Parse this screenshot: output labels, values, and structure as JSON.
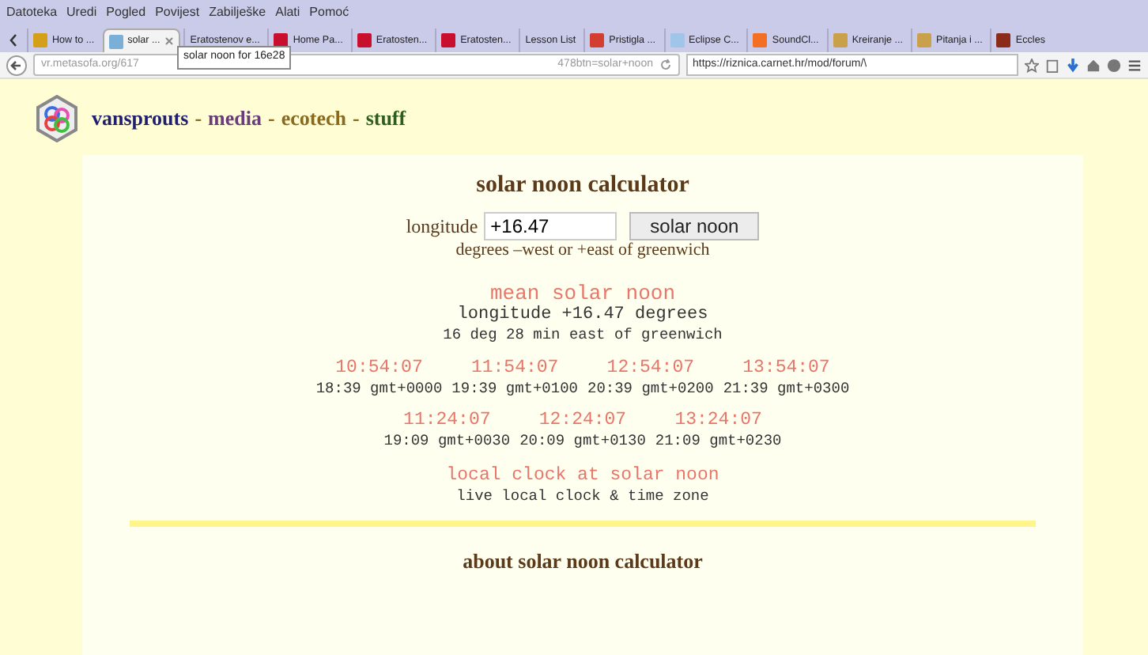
{
  "menu": [
    "Datoteka",
    "Uredi",
    "Pogled",
    "Povijest",
    "Zabilješke",
    "Alati",
    "Pomoć"
  ],
  "tabs": [
    {
      "label": "How to ...",
      "selected": false,
      "color": "#d4a017"
    },
    {
      "label": "solar ...",
      "selected": true,
      "color": "#7ab0d8"
    },
    {
      "label": "Eratostenov e...",
      "selected": false
    },
    {
      "label": "Home Pa...",
      "selected": false,
      "color": "#c8102e"
    },
    {
      "label": "Eratosten...",
      "selected": false,
      "color": "#c8102e"
    },
    {
      "label": "Eratosten...",
      "selected": false,
      "color": "#c8102e"
    },
    {
      "label": "Lesson List",
      "selected": false
    },
    {
      "label": "Pristigla ...",
      "selected": false,
      "color": "#d23f31"
    },
    {
      "label": "Eclipse C...",
      "selected": false,
      "color": "#9fc5e8"
    },
    {
      "label": "SoundCl...",
      "selected": false,
      "color": "#f26f23"
    },
    {
      "label": "Kreiranje ...",
      "selected": false,
      "color": "#c9a14a"
    },
    {
      "label": "Pitanja i ...",
      "selected": false,
      "color": "#c9a14a"
    },
    {
      "label": "Eccles",
      "selected": false,
      "color": "#8b2b1a"
    }
  ],
  "address": {
    "url_start": "vr.metasofa.org/617",
    "url_end": "478btn=solar+noon",
    "tooltip": "solar noon for 16e28"
  },
  "search": {
    "value": "https://riznica.carnet.hr/mod/forum/\\"
  },
  "nav_separator": "-",
  "site_nav": [
    {
      "label": "vansprouts",
      "color": "#1f1f6e"
    },
    {
      "label": "media",
      "color": "#6a3d7a"
    },
    {
      "label": "ecotech",
      "color": "#8a6a1e"
    },
    {
      "label": "stuff",
      "color": "#2e5e1e"
    }
  ],
  "calculator": {
    "title": "solar noon calculator",
    "label": "longitude",
    "value": "+16.47",
    "button": "solar noon",
    "hint": "degrees –west or +east of greenwich"
  },
  "result": {
    "heading": "mean solar noon",
    "line_1": "longitude +16.47 degrees",
    "line_2": "16 deg 28 min east of greenwich"
  },
  "time_groups": [
    [
      {
        "local": "10:54:07",
        "gmt": "18:39 gmt+0000"
      },
      {
        "local": "11:54:07",
        "gmt": "19:39 gmt+0100"
      },
      {
        "local": "12:54:07",
        "gmt": "20:39 gmt+0200"
      },
      {
        "local": "13:54:07",
        "gmt": "21:39 gmt+0300"
      }
    ],
    [
      {
        "local": "11:24:07",
        "gmt": "19:09 gmt+0030"
      },
      {
        "local": "12:24:07",
        "gmt": "20:09 gmt+0130"
      },
      {
        "local": "13:24:07",
        "gmt": "21:09 gmt+0230"
      }
    ]
  ],
  "local_clock": {
    "heading": "local clock at solar noon",
    "subline": "live local clock & time zone"
  },
  "about": {
    "heading": "about solar noon calculator"
  }
}
